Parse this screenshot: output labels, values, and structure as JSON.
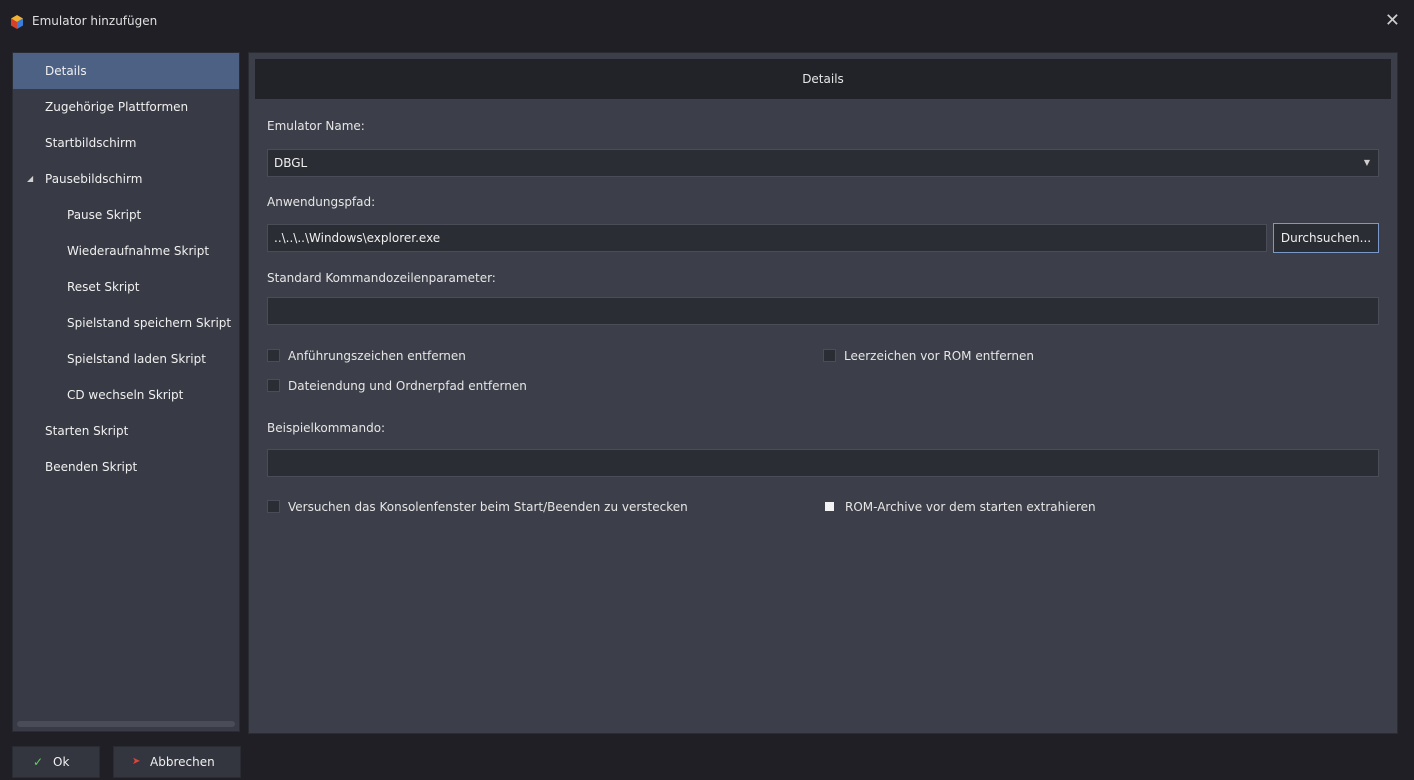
{
  "window": {
    "title": "Emulator hinzufügen",
    "close_glyph": "✕",
    "app_icon": "launchbox-cube-icon"
  },
  "sidebar": {
    "items": [
      {
        "label": "Details",
        "active": true,
        "level": 0
      },
      {
        "label": "Zugehörige Plattformen",
        "level": 0
      },
      {
        "label": "Startbildschirm",
        "level": 0
      },
      {
        "label": "Pausebildschirm",
        "level": 0,
        "expanded": true
      },
      {
        "label": "Pause Skript",
        "level": 1
      },
      {
        "label": "Wiederaufnahme Skript",
        "level": 1
      },
      {
        "label": "Reset Skript",
        "level": 1
      },
      {
        "label": "Spielstand speichern Skript",
        "level": 1
      },
      {
        "label": "Spielstand laden Skript",
        "level": 1
      },
      {
        "label": "CD wechseln Skript",
        "level": 1
      },
      {
        "label": "Starten Skript",
        "level": 0
      },
      {
        "label": "Beenden Skript",
        "level": 0
      }
    ],
    "expand_glyph": "◢"
  },
  "main": {
    "header": "Details",
    "emulator_name_label": "Emulator Name:",
    "emulator_name_value": "DBGL",
    "app_path_label": "Anwendungspfad:",
    "app_path_value": "..\\..\\..\\Windows\\explorer.exe",
    "browse_label": "Durchsuchen...",
    "cmdline_label": "Standard Kommandozeilenparameter:",
    "cmdline_value": "",
    "checkboxes": {
      "remove_quotes": {
        "label": "Anführungszeichen entfernen",
        "checked": false
      },
      "remove_space_before_rom": {
        "label": "Leerzeichen vor ROM entfernen",
        "checked": false
      },
      "remove_ext_and_path": {
        "label": "Dateiendung und Ordnerpfad entfernen",
        "checked": false
      },
      "hide_console": {
        "label": "Versuchen das Konsolenfenster beim Start/Beenden zu verstecken",
        "checked": false
      },
      "extract_rom_archives": {
        "label": "ROM-Archive vor dem starten extrahieren",
        "checked": true
      }
    },
    "example_label": "Beispielkommando:",
    "example_value": ""
  },
  "footer": {
    "ok_label": "Ok",
    "cancel_label": "Abbrechen",
    "ok_icon": "✓",
    "cancel_icon": "➤"
  },
  "colors": {
    "accent_selected": "#4d6184",
    "ok_icon": "#5fd35f",
    "cancel_icon": "#e0433a",
    "browse_border": "#7a98c8"
  }
}
